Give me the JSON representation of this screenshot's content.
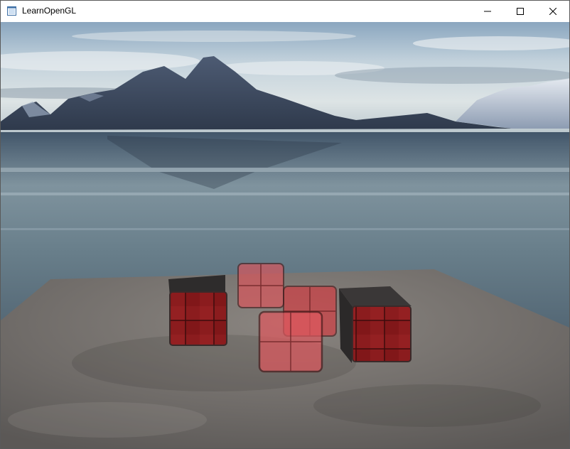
{
  "window": {
    "title": "LearnOpenGL",
    "app_icon": "window-app-icon",
    "controls": [
      {
        "name": "minimize-button",
        "icon": "minimize-icon"
      },
      {
        "name": "maximize-button",
        "icon": "maximize-icon"
      },
      {
        "name": "close-button",
        "icon": "close-icon"
      }
    ]
  },
  "scene": {
    "description_icon": "opengl-render",
    "colors": {
      "sky_top": "#9fb4c4",
      "water": "#6f8592",
      "floor": "#77736f",
      "crate_red": "#8e1d1e",
      "glass_red": "#d63a3f"
    }
  }
}
